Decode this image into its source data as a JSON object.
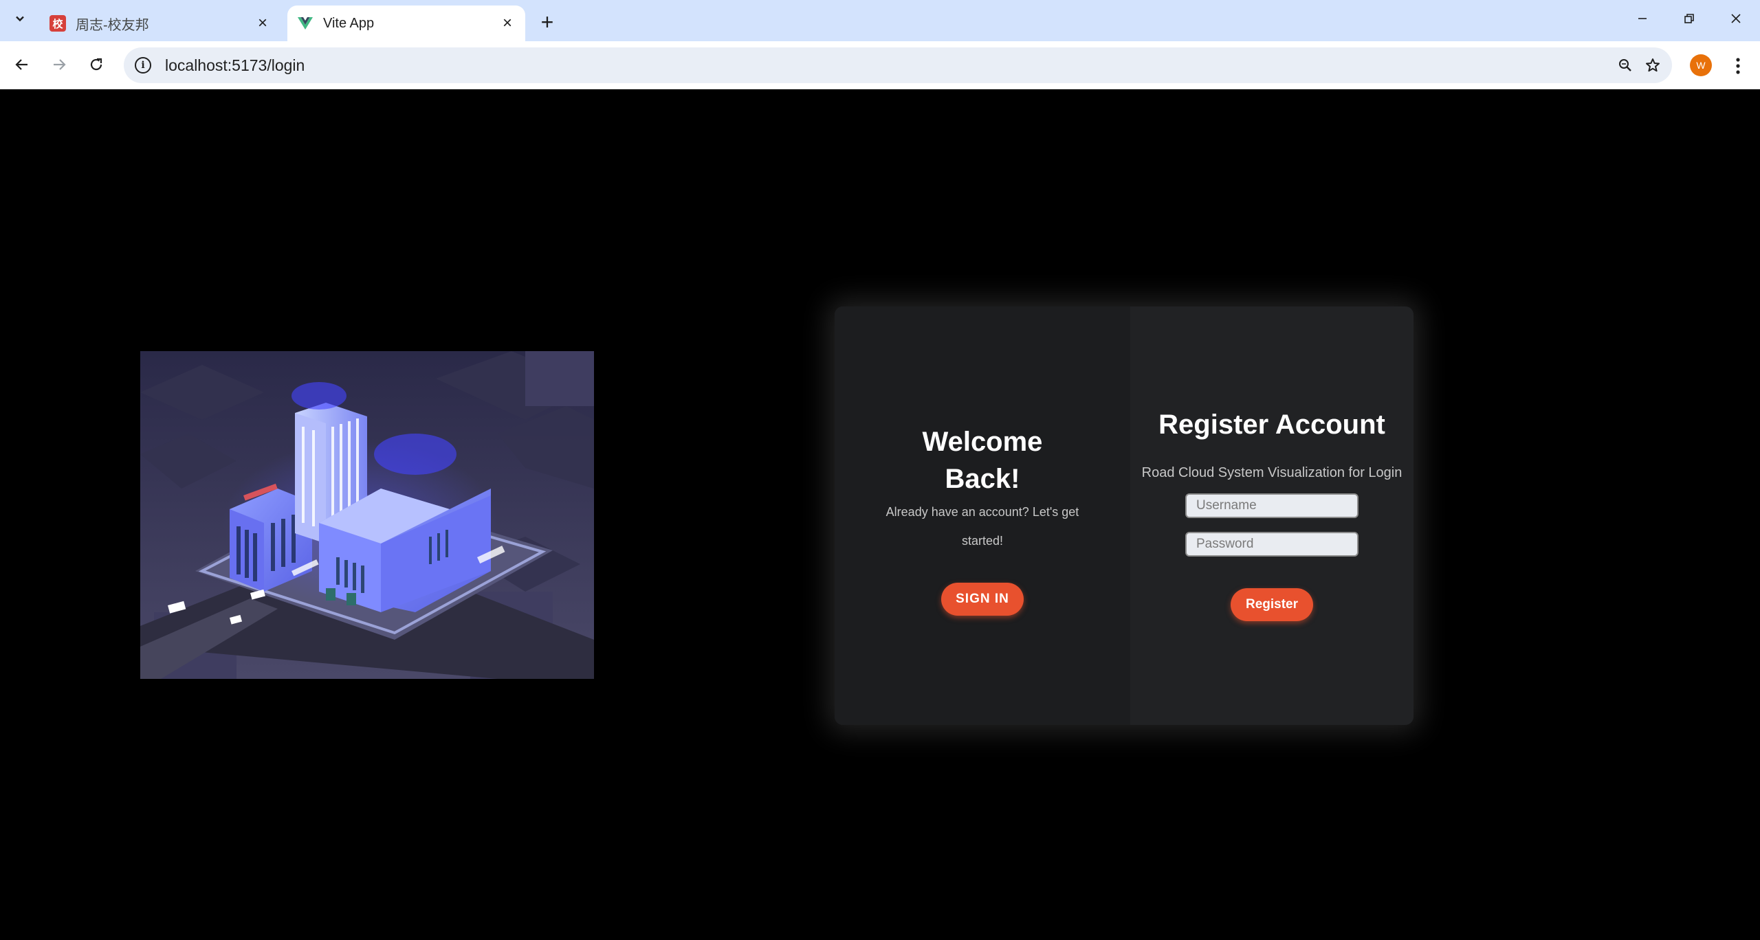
{
  "browser": {
    "tabs": [
      {
        "title": "周志-校友邦",
        "favicon": "校",
        "active": false
      },
      {
        "title": "Vite App",
        "active": true
      }
    ],
    "url": "localhost:5173/login",
    "profile_initial": "W",
    "icons": {
      "tab_search": "chevron-down-icon",
      "close": "close-icon",
      "new_tab": "plus-icon",
      "back": "back-arrow-icon",
      "forward": "forward-arrow-icon",
      "reload": "reload-icon",
      "site_info": "info-icon",
      "zoom": "zoom-icon",
      "bookmark": "star-icon",
      "menu": "kebab-menu-icon"
    }
  },
  "login": {
    "welcome_title": "Welcome Back!",
    "welcome_text": "Already have an account? Let's get started!",
    "sign_in_label": "SIGN IN",
    "register_title": "Register Account",
    "register_subtitle": "Road Cloud System Visualization for Login",
    "username_placeholder": "Username",
    "password_placeholder": "Password",
    "register_label": "Register"
  },
  "colors": {
    "accent": "#e8512e",
    "card_bg": "#1f2022",
    "page_bg": "#000000",
    "tabstrip_bg": "#d3e3fd"
  }
}
